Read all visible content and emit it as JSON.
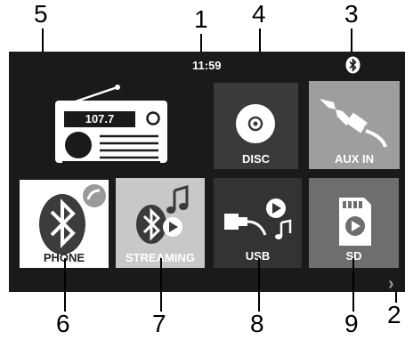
{
  "callouts": [
    "1",
    "2",
    "3",
    "4",
    "5",
    "6",
    "7",
    "8",
    "9"
  ],
  "status_bar": {
    "time": "11:59",
    "bluetooth_icon": "bluetooth-icon"
  },
  "radio": {
    "frequency": "107.7",
    "icon": "radio-icon"
  },
  "tiles": {
    "disc": {
      "label": "DISC",
      "icon": "disc-icon"
    },
    "aux": {
      "label": "AUX IN",
      "icon": "aux-jack-icon"
    },
    "phone": {
      "label": "PHONE",
      "icon": "bluetooth-phone-icon"
    },
    "streaming": {
      "label": "STREAMING",
      "icon": "bluetooth-music-icon"
    },
    "usb": {
      "label": "USB",
      "icon": "usb-music-icon"
    },
    "sd": {
      "label": "SD",
      "icon": "sd-card-icon"
    }
  },
  "next_page_icon": "chevron-right-icon",
  "colors": {
    "screen_bg": "#1a1a1a",
    "disc_tile": "#3a3a3a",
    "aux_tile": "#9e9e9e",
    "phone_tile": "#ffffff",
    "streaming_tile": "#c8c8c8",
    "usb_tile": "#333333",
    "sd_tile": "#6e6e6e"
  }
}
